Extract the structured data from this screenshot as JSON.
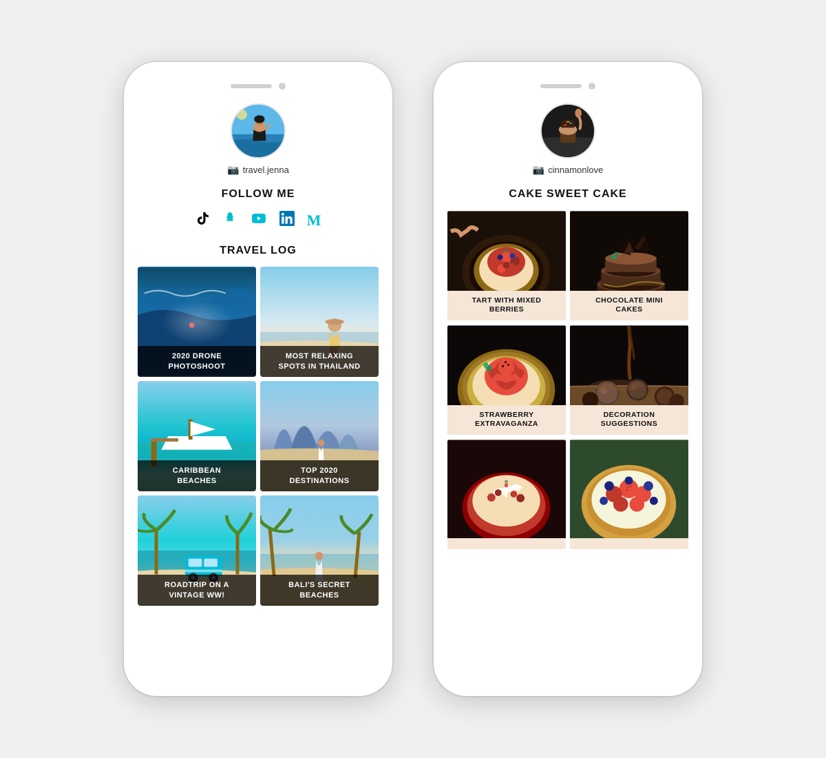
{
  "phone1": {
    "username": "travel.jenna",
    "follow_title": "FOLLOW ME",
    "travel_log_title": "TRAVEL LOG",
    "social_icons": [
      {
        "name": "tiktok",
        "symbol": "♪",
        "label": "TikTok"
      },
      {
        "name": "snapchat",
        "symbol": "👻",
        "label": "Snapchat"
      },
      {
        "name": "youtube",
        "symbol": "▶",
        "label": "YouTube"
      },
      {
        "name": "linkedin",
        "symbol": "in",
        "label": "LinkedIn"
      },
      {
        "name": "medium",
        "symbol": "M",
        "label": "Medium"
      }
    ],
    "posts": [
      {
        "id": "drone",
        "caption": "2020 DRONE\nPHOTOSHOOT"
      },
      {
        "id": "thailand",
        "caption": "MOST RELAXING\nSPOTS IN THAILAND"
      },
      {
        "id": "caribbean",
        "caption": "CARIBBEAN\nBEACHES"
      },
      {
        "id": "destinations",
        "caption": "TOP 2020\nDESTINATIONS"
      },
      {
        "id": "roadtrip",
        "caption": "ROADTRIP ON A\nVINTAGE WW!"
      },
      {
        "id": "bali",
        "caption": "BALI'S SECRET\nBEACHES"
      }
    ]
  },
  "phone2": {
    "username": "cinnamonlove",
    "blog_title": "CAKE SWEET CAKE",
    "posts": [
      {
        "id": "tart-berries",
        "caption": "TART WITH MIXED\nBERRIES"
      },
      {
        "id": "choc-mini",
        "caption": "CHOCOLATE MINI\nCAKES"
      },
      {
        "id": "strawberry",
        "caption": "STRAWBERRY\nEXTRAVAGANZA"
      },
      {
        "id": "decoration",
        "caption": "DECORATION\nSUGGESTIONS"
      },
      {
        "id": "red-cake",
        "caption": ""
      },
      {
        "id": "berry-tart",
        "caption": ""
      }
    ]
  }
}
